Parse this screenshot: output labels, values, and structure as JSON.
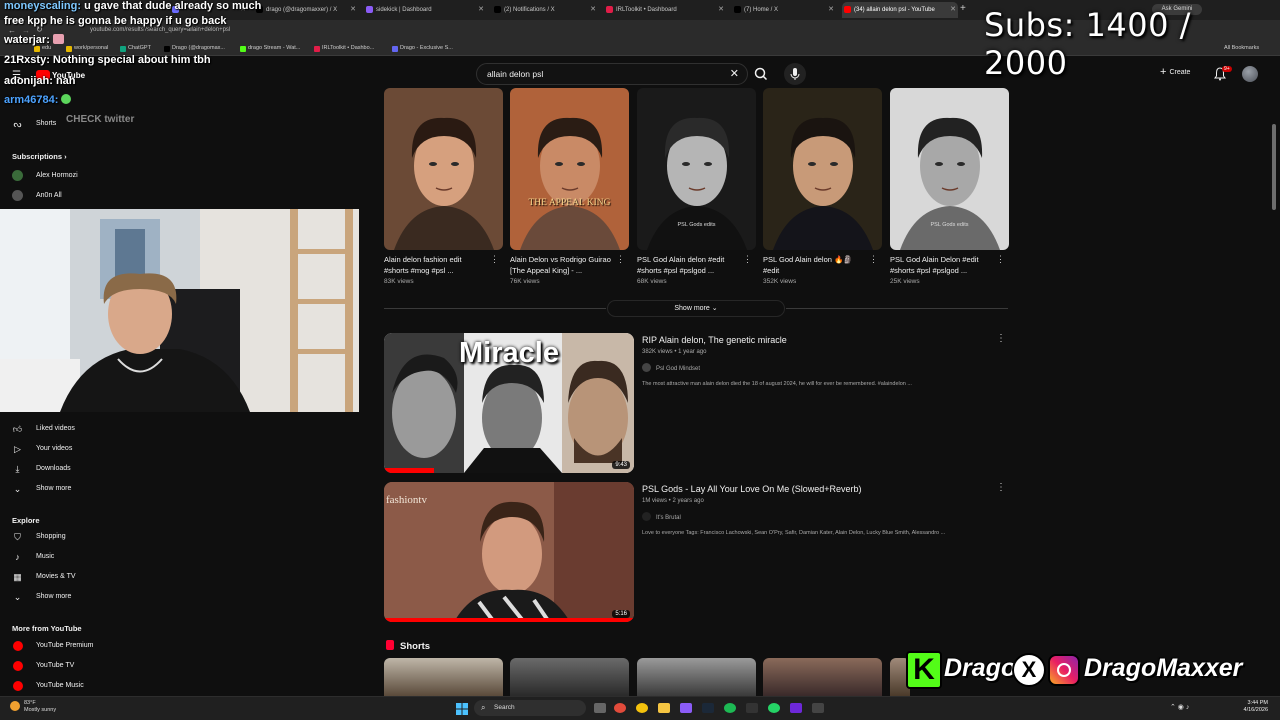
{
  "browser": {
    "tabs": [
      {
        "label": "",
        "color": "#6b6bff"
      },
      {
        "label": "drago (@dragomaxxer) / X",
        "color": "#000000"
      },
      {
        "label": "sidekick | Dashboard",
        "color": "#8b5cf6"
      },
      {
        "label": "(2) Notifications / X",
        "color": "#000000"
      },
      {
        "label": "IRLToolkit • Dashboard",
        "color": "#e11d48"
      },
      {
        "label": "(7) Home / X",
        "color": "#000000"
      },
      {
        "label": "(34) allain delon psl - YouTube",
        "color": "#ff0000"
      }
    ],
    "ask_gemini": "Ask Gemini",
    "url": "youtube.com/results?search_query=allain+delon+psl",
    "bookmarks": [
      {
        "label": "edu",
        "color": "#e6b800"
      },
      {
        "label": "work/personal",
        "color": "#e6b800"
      },
      {
        "label": "ChatGPT",
        "color": "#10a37f"
      },
      {
        "label": "Drago (@dragomax...",
        "color": "#000000"
      },
      {
        "label": "drago Stream - Wat...",
        "color": "#53fc18"
      },
      {
        "label": "IRLToolkit • Dashbo...",
        "color": "#e11d48"
      },
      {
        "label": "Drago - Exclusive S...",
        "color": "#6366f1"
      }
    ],
    "all_bookmarks": "All Bookmarks"
  },
  "youtube": {
    "search_value": "allain delon psl",
    "create_label": "Create",
    "notif_count": "9+"
  },
  "sidebar": {
    "shorts": "Shorts",
    "subscriptions_heading": "Subscriptions",
    "subscriptions": [
      {
        "label": "Alex Hormozi"
      },
      {
        "label": "An0n All"
      }
    ],
    "you_items": [
      {
        "label": "Liked videos",
        "icon": "thumbs-up-icon"
      },
      {
        "label": "Your videos",
        "icon": "play-square-icon"
      },
      {
        "label": "Downloads",
        "icon": "download-icon"
      },
      {
        "label": "Show more",
        "icon": "chevron-down-icon"
      }
    ],
    "explore_heading": "Explore",
    "explore_items": [
      {
        "label": "Shopping",
        "icon": "bag-icon"
      },
      {
        "label": "Music",
        "icon": "music-note-icon"
      },
      {
        "label": "Movies & TV",
        "icon": "film-icon"
      },
      {
        "label": "Show more",
        "icon": "chevron-down-icon"
      }
    ],
    "more_heading": "More from YouTube",
    "more_items": [
      {
        "label": "YouTube Premium"
      },
      {
        "label": "YouTube TV"
      },
      {
        "label": "YouTube Music"
      }
    ]
  },
  "chat": [
    {
      "name": "moneyscaling:",
      "msg": " u gave that dude already so much",
      "color": "#7ec8ff"
    },
    {
      "name": "",
      "msg": "free kpp he is gonna be happy if u go back",
      "color": "#ffffff"
    },
    {
      "name": "waterjar:",
      "msg": "",
      "color": "#ffffff"
    },
    {
      "name": "21Rxsty:",
      "msg": " Nothing special about him tbh",
      "color": "#ffffff"
    },
    {
      "name": "adonijah:",
      "msg": " nah",
      "color": "#ffffff"
    },
    {
      "name": "arm46784:",
      "msg": "",
      "color": "#4da3ff"
    },
    {
      "name": "",
      "msg": "CHECK twitter",
      "color": "#888888"
    }
  ],
  "subs_counter": "Subs: 1400 / 2000",
  "grid": [
    {
      "title": "Alain delon fashion edit #shorts #mog #psl ...",
      "views": "83K views",
      "caption": ""
    },
    {
      "title": "Alain Delon vs Rodrigo Guirao [The Appeal King] - ...",
      "views": "76K views",
      "caption": "THE APPEAL KING"
    },
    {
      "title": "PSL God Alain delon #edit #shorts #psl #pslgod ...",
      "views": "68K views",
      "caption": "PSL Gods edits"
    },
    {
      "title": "PSL God Alain delon 🔥🗿 #edit",
      "views": "352K views",
      "caption": ""
    },
    {
      "title": "PSL God Alain Delon #edit #shorts #psl #pslgod ...",
      "views": "25K views",
      "caption": "PSL Gods edits"
    }
  ],
  "show_more": "Show more",
  "results": [
    {
      "title": "RIP Alain delon, The genetic miracle",
      "meta": "382K views • 1 year ago",
      "channel": "Psl God Mindset",
      "desc": "The most attractive man alain delon died the 18 of august 2024, he will for ever be remembered. #alaindelon ...",
      "duration": "9:43",
      "thumb_text": "Miracle"
    },
    {
      "title": "PSL Gods - Lay All Your Love On Me (Slowed+Reverb)",
      "meta": "1M views • 2 years ago",
      "channel": "It's Brutal",
      "desc": "Love to everyone Tags: Francisco Lachowski, Sean O'Pry, Safir, Damian Kater, Alain Delon, Lucky Blue Smith, Alessandro ...",
      "duration": "5:16",
      "thumb_text": "fashiontv"
    }
  ],
  "shorts_heading": "Shorts",
  "banner": {
    "k": "K",
    "name1": "Drago",
    "name2": "DragoMaxxer"
  },
  "taskbar": {
    "temp": "83°F",
    "weather": "Mostly sunny",
    "search": "Search",
    "time": "3:44 PM",
    "date": "4/16/2026"
  }
}
